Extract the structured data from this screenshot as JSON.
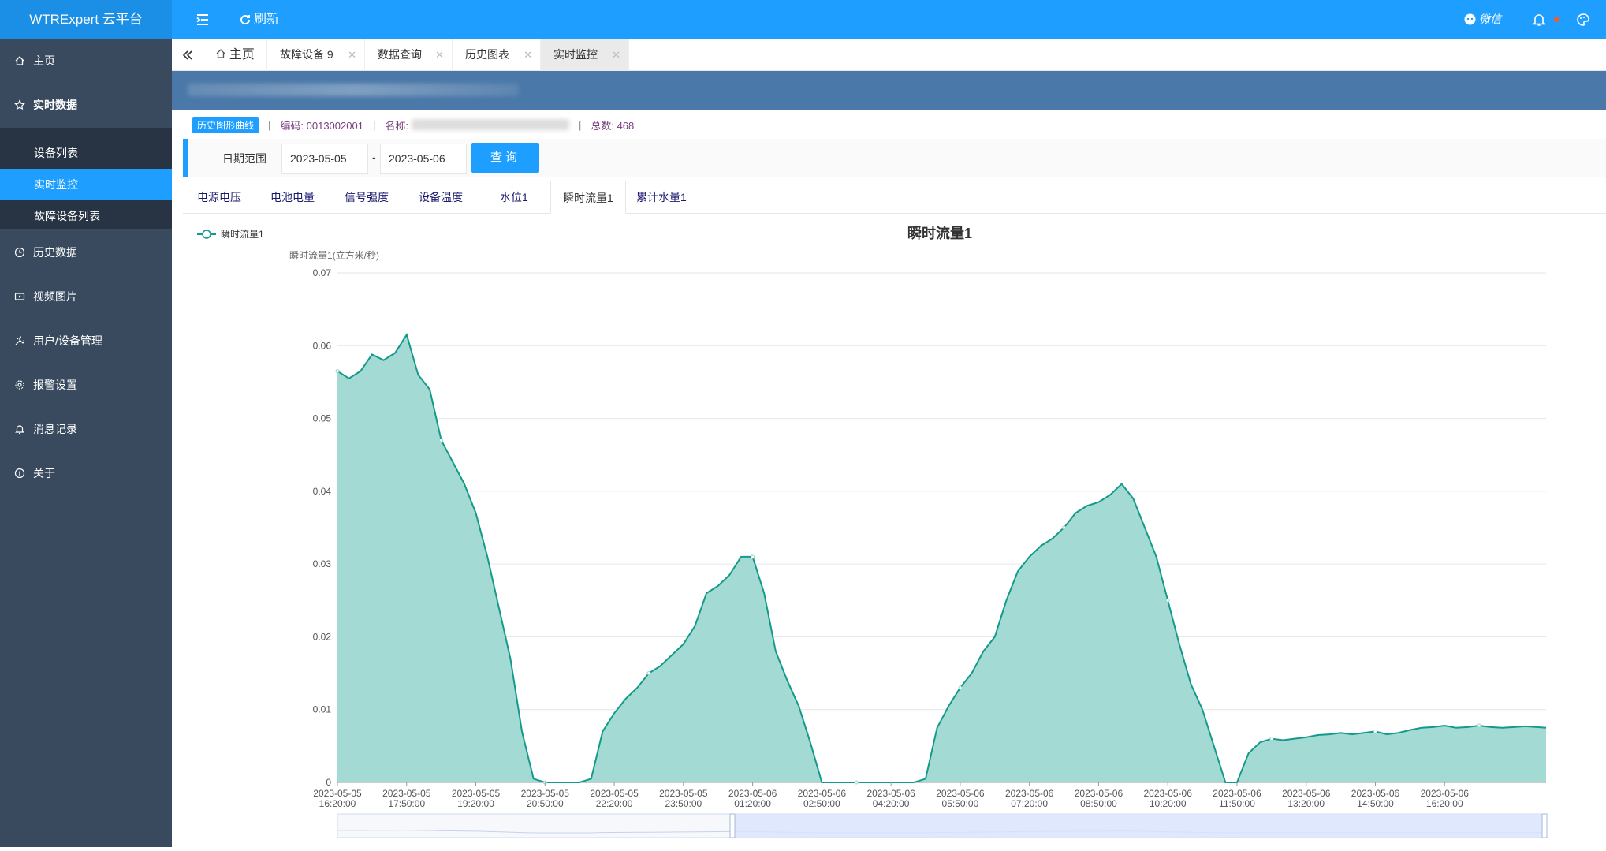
{
  "app": {
    "brand": "WTRExpert 云平台",
    "refresh_label": "刷新",
    "wechat_label": "微信"
  },
  "sidebar": {
    "items": [
      {
        "label": "主页",
        "icon": "home-icon"
      },
      {
        "label": "实时数据",
        "icon": "star-icon"
      },
      {
        "label": "历史数据",
        "icon": "clock-icon"
      },
      {
        "label": "视频图片",
        "icon": "video-icon"
      },
      {
        "label": "用户/设备管理",
        "icon": "tools-icon"
      },
      {
        "label": "报警设置",
        "icon": "gear-icon"
      },
      {
        "label": "消息记录",
        "icon": "bell-icon"
      },
      {
        "label": "关于",
        "icon": "info-icon"
      }
    ],
    "sub_items": [
      {
        "label": "设备列表"
      },
      {
        "label": "实时监控"
      },
      {
        "label": "故障设备列表"
      }
    ]
  },
  "tabs": [
    {
      "label": "主页"
    },
    {
      "label": "故障设备 9"
    },
    {
      "label": "数据查询"
    },
    {
      "label": "历史图表"
    },
    {
      "label": "实时监控"
    }
  ],
  "info": {
    "badge": "历史图形曲线",
    "code_label": "编码: 0013002001",
    "name_label": "名称:",
    "total_label": "总数: 468"
  },
  "filter": {
    "label": "日期范围",
    "start": "2023-05-05",
    "end": "2023-05-06",
    "dash": "-",
    "query_label": "查询"
  },
  "metric_tabs": [
    "电源电压",
    "电池电量",
    "信号强度",
    "设备温度",
    "水位1",
    "瞬时流量1",
    "累计水量1"
  ],
  "colors": {
    "accent": "#1e9fff",
    "sidebar": "#394a5f",
    "series_line": "#139a8a",
    "series_fill": "#a3dad4"
  },
  "chart_data": {
    "type": "area",
    "title": "瞬时流量1",
    "ylabel": "瞬时流量1(立方米/秒)",
    "legend": [
      "瞬时流量1"
    ],
    "legend_position": "top-left",
    "ylim": [
      0,
      0.07
    ],
    "yticks": [
      "0",
      "0.01",
      "0.02",
      "0.03",
      "0.04",
      "0.05",
      "0.06",
      "0.07"
    ],
    "xticks": [
      [
        "2023-05-05",
        "16:20:00"
      ],
      [
        "2023-05-05",
        "17:50:00"
      ],
      [
        "2023-05-05",
        "19:20:00"
      ],
      [
        "2023-05-05",
        "20:50:00"
      ],
      [
        "2023-05-05",
        "22:20:00"
      ],
      [
        "2023-05-05",
        "23:50:00"
      ],
      [
        "2023-05-06",
        "01:20:00"
      ],
      [
        "2023-05-06",
        "02:50:00"
      ],
      [
        "2023-05-06",
        "04:20:00"
      ],
      [
        "2023-05-06",
        "05:50:00"
      ],
      [
        "2023-05-06",
        "07:20:00"
      ],
      [
        "2023-05-06",
        "08:50:00"
      ],
      [
        "2023-05-06",
        "10:20:00"
      ],
      [
        "2023-05-06",
        "11:50:00"
      ],
      [
        "2023-05-06",
        "13:20:00"
      ],
      [
        "2023-05-06",
        "14:50:00"
      ],
      [
        "2023-05-06",
        "16:20:00"
      ]
    ],
    "grid": true,
    "x_hours": [
      0,
      0.25,
      0.5,
      0.75,
      1.0,
      1.25,
      1.5,
      1.75,
      2.0,
      2.25,
      2.5,
      2.75,
      3.0,
      3.25,
      3.5,
      3.75,
      4.0,
      4.25,
      4.5,
      4.75,
      5.0,
      5.25,
      5.5,
      5.75,
      6.0,
      6.25,
      6.5,
      6.75,
      7.0,
      7.25,
      7.5,
      7.75,
      8.0,
      8.25,
      8.5,
      8.75,
      9.0,
      9.25,
      9.5,
      9.75,
      10.0,
      10.25,
      10.5,
      10.75,
      11.0,
      11.25,
      11.5,
      11.75,
      12.0,
      12.25,
      12.5,
      12.75,
      13.0,
      13.25,
      13.5,
      13.75,
      14.0,
      14.25,
      14.5,
      14.75,
      15.0,
      15.25,
      15.5,
      15.75,
      16.0,
      16.25,
      16.5,
      16.75,
      17.0,
      17.25,
      17.5,
      17.75,
      18.0,
      18.25,
      18.5,
      18.75,
      19.0,
      19.25,
      19.5,
      19.75,
      20.0,
      20.25,
      20.5,
      20.75,
      21.0,
      21.25,
      21.5,
      21.75,
      22.0,
      22.25,
      22.5,
      22.75,
      23.0,
      23.25,
      23.5,
      23.75,
      24.0,
      24.25,
      24.5,
      24.75,
      25.0,
      25.25,
      25.5,
      25.75,
      26.0,
      26.2
    ],
    "values": [
      0.0565,
      0.0555,
      0.0565,
      0.0588,
      0.058,
      0.059,
      0.0615,
      0.056,
      0.054,
      0.047,
      0.044,
      0.041,
      0.037,
      0.031,
      0.024,
      0.017,
      0.007,
      0.0005,
      0.0,
      0.0,
      0.0,
      0.0,
      0.0005,
      0.007,
      0.0095,
      0.0115,
      0.013,
      0.015,
      0.016,
      0.0175,
      0.019,
      0.0215,
      0.026,
      0.027,
      0.0285,
      0.031,
      0.031,
      0.026,
      0.018,
      0.014,
      0.0105,
      0.0055,
      0.0,
      0.0,
      0.0,
      0.0,
      0.0,
      0.0,
      0.0,
      0.0,
      0.0,
      0.0005,
      0.0075,
      0.0105,
      0.013,
      0.015,
      0.018,
      0.02,
      0.025,
      0.029,
      0.031,
      0.0325,
      0.0335,
      0.035,
      0.037,
      0.038,
      0.0385,
      0.0395,
      0.041,
      0.039,
      0.035,
      0.031,
      0.025,
      0.019,
      0.0135,
      0.01,
      0.005,
      0.0,
      0.0,
      0.004,
      0.0055,
      0.006,
      0.0058,
      0.006,
      0.0062,
      0.0065,
      0.0066,
      0.0068,
      0.0066,
      0.0068,
      0.007,
      0.0066,
      0.0068,
      0.0072,
      0.0075,
      0.0076,
      0.0078,
      0.0075,
      0.0076,
      0.0078,
      0.0076,
      0.0075,
      0.0076,
      0.0077,
      0.0076,
      0.0075
    ]
  }
}
